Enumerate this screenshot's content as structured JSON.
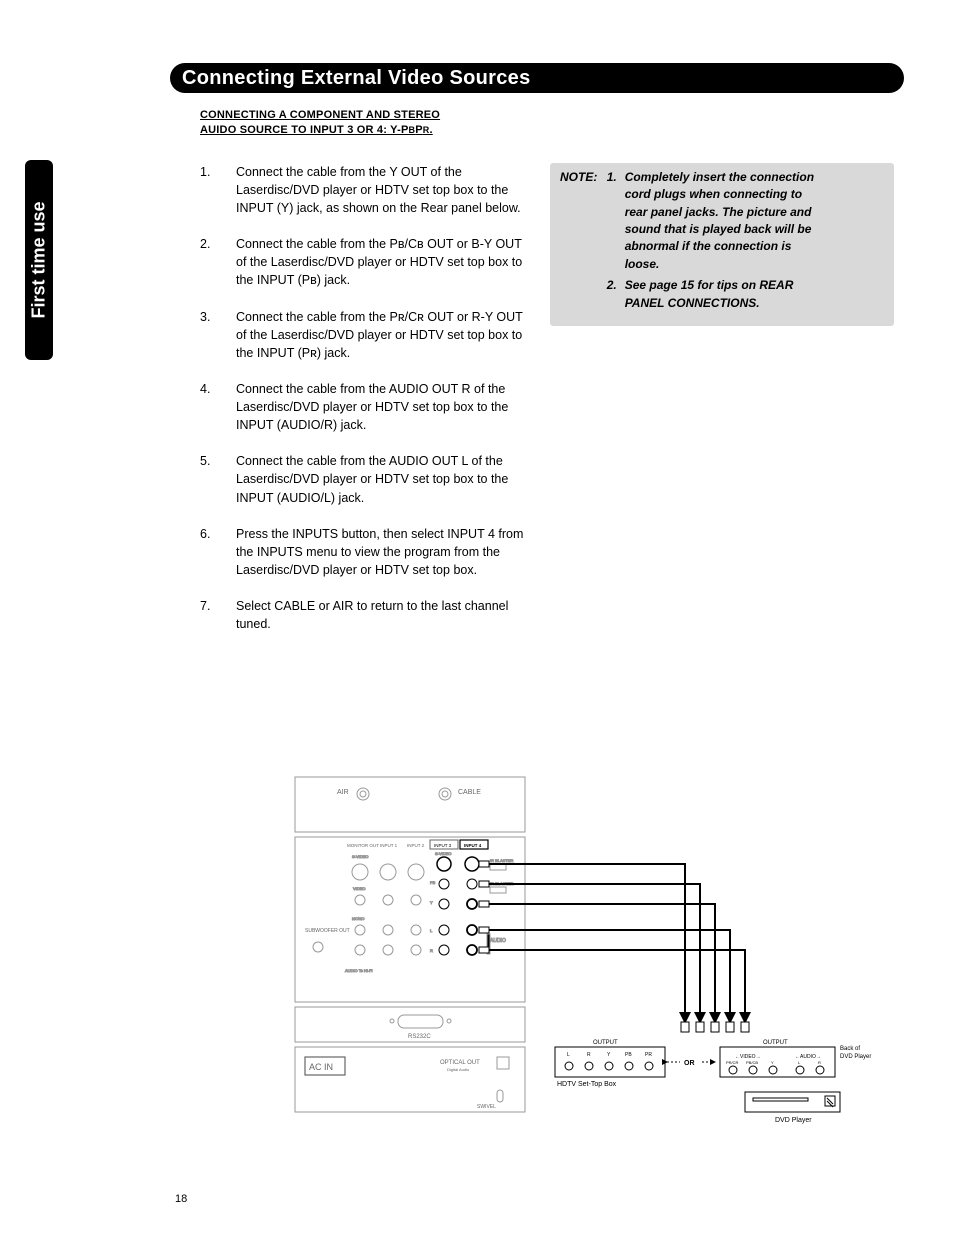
{
  "title_bar": "Connecting External Video Sources",
  "side_tab": "First time use",
  "section_heading_line1": "CONNECTING A COMPONENT AND STEREO",
  "section_heading_line2_a": "AUIDO SOURCE TO INPUT 3 OR 4: Y-P",
  "section_heading_line2_b": "B",
  "section_heading_line2_c": "P",
  "section_heading_line2_d": "R",
  "section_heading_line2_e": ".",
  "steps": [
    "Connect the cable from the Y OUT of the Laserdisc/DVD player or HDTV set top box to the INPUT (Y) jack, as shown on the Rear panel below.",
    "Connect the cable from the Pʙ/Cʙ OUT or B-Y OUT of the Laserdisc/DVD player or HDTV set top box to the INPUT (Pʙ) jack.",
    "Connect the cable from the Pʀ/Cʀ OUT or R-Y OUT of the Laserdisc/DVD player or HDTV set top box to the INPUT (Pʀ) jack.",
    "Connect the cable from the AUDIO OUT R of the Laserdisc/DVD player or HDTV set top box to the INPUT (AUDIO/R) jack.",
    "Connect the cable from the AUDIO OUT L of the Laserdisc/DVD player or HDTV set top box to the INPUT (AUDIO/L) jack.",
    "Press the INPUTS button, then select INPUT 4 from the INPUTS menu to view the program from the Laserdisc/DVD player or HDTV set top box.",
    "Select CABLE or AIR to return to the last channel tuned."
  ],
  "note_label": "NOTE:",
  "notes": [
    "Completely insert the connection cord plugs when connecting to rear panel jacks. The picture and sound that is played back will be abnormal if the connection is loose.",
    "See page 15 for tips on REAR PANEL CONNECTIONS."
  ],
  "diagram": {
    "tv_ant": {
      "air": "AIR",
      "cable": "CABLE"
    },
    "tv_inputs": {
      "monitor_out": "MONITOR OUT",
      "input1": "INPUT 1",
      "input2": "INPUT 2",
      "input3": "INPUT 3",
      "input4": "INPUT 4",
      "svideo": "S-VIDEO",
      "video": "VIDEO",
      "mono": "MONO",
      "ir_blaster": "IR BLASTER",
      "audio": "AUDIO",
      "Y": "Y",
      "PB": "PB",
      "PR": "PR",
      "L": "L",
      "R": "R",
      "subwoofer": "SUBWOOFER OUT",
      "audio_to_hifi": "AUDIO To Hi-Fi"
    },
    "tv_misc": {
      "rs232c": "RS232C",
      "ac_in": "AC IN",
      "optical_out": "OPTICAL OUT",
      "digital_audio": "Digital Audio",
      "swivel": "SWIVEL"
    },
    "stb": {
      "title": "OUTPUT",
      "labels": [
        "L",
        "R",
        "Y",
        "PB",
        "PR"
      ],
      "caption": "HDTV Set-Top Box"
    },
    "or": "OR",
    "dvd_back": {
      "title": "OUTPUT",
      "video_group": "VIDEO",
      "video_labels": [
        "PR/CR",
        "PB/CB",
        "Y"
      ],
      "audio_group": "AUDIO",
      "audio_labels": [
        "L",
        "R"
      ],
      "caption_side": "Back of DVD Player"
    },
    "dvd_unit": "DVD Player"
  },
  "page_number": "18"
}
